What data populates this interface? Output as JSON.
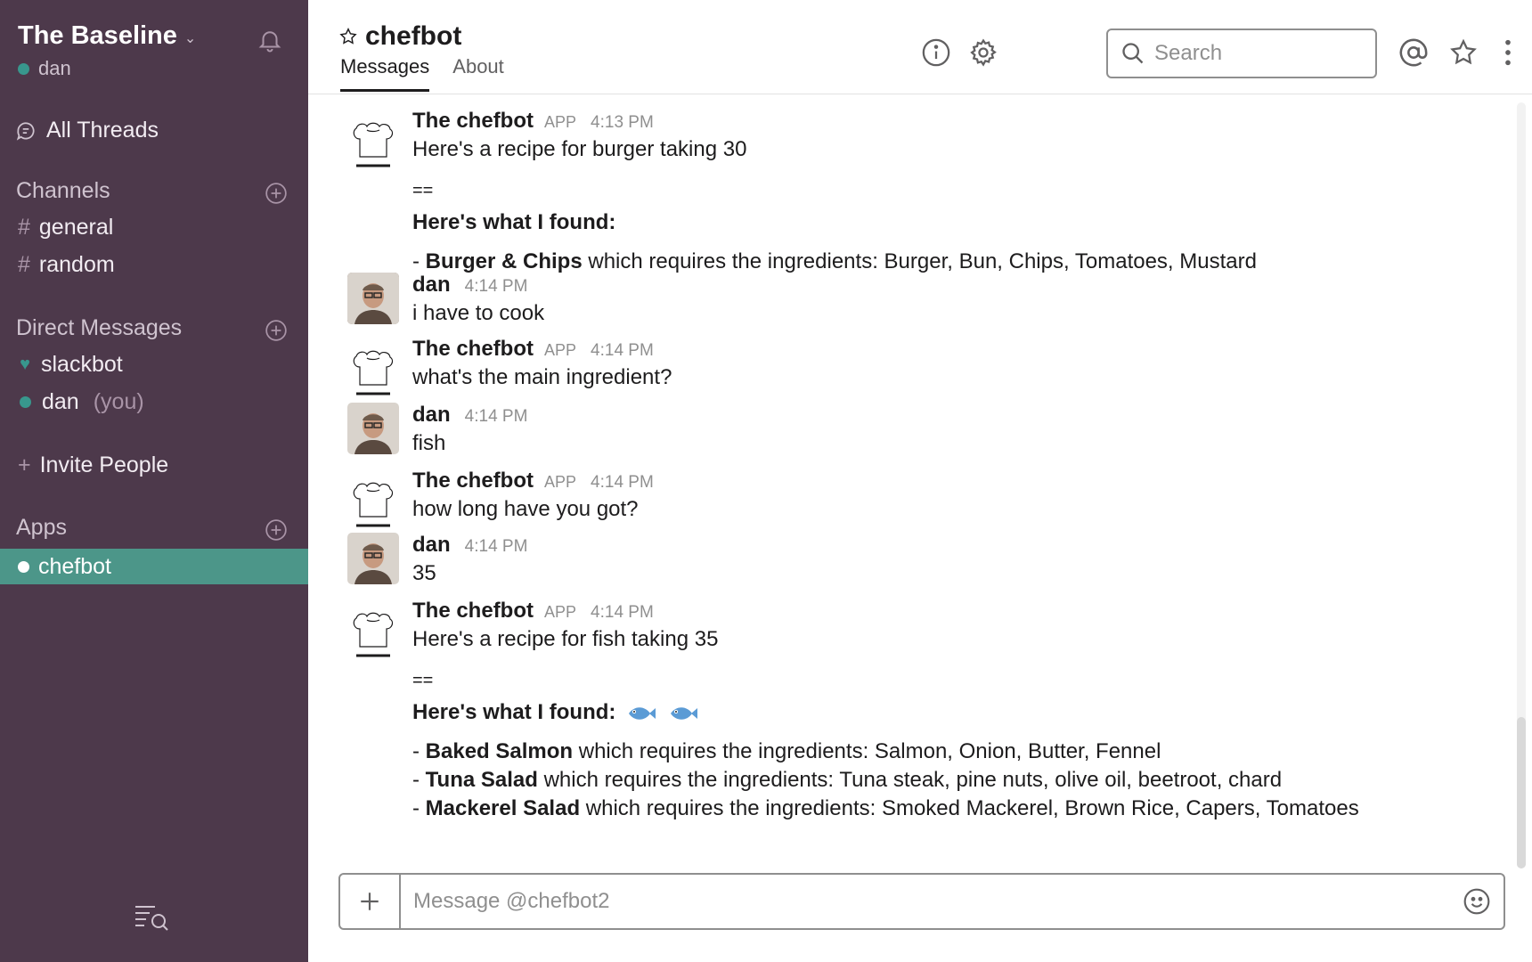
{
  "sidebar": {
    "team_name": "The Baseline",
    "user_name": "dan",
    "all_threads": "All Threads",
    "channels_heading": "Channels",
    "channels": [
      {
        "prefix": "#",
        "name": "general"
      },
      {
        "prefix": "#",
        "name": "random"
      }
    ],
    "dm_heading": "Direct Messages",
    "dms": [
      {
        "name": "slackbot",
        "suffix": ""
      },
      {
        "name": "dan",
        "suffix": "(you)"
      }
    ],
    "invite": "Invite People",
    "invite_prefix": "+",
    "apps_heading": "Apps",
    "active_app": "chefbot"
  },
  "header": {
    "channel_name": "chefbot",
    "tabs": [
      "Messages",
      "About"
    ],
    "search_placeholder": "Search"
  },
  "messages": [
    {
      "author": "The chefbot",
      "badge": "APP",
      "time": "4:13 PM",
      "lines": [
        "Here's a recipe for burger taking 30",
        "==",
        "Here's what I found:"
      ],
      "recipes": [
        {
          "dash": "- ",
          "name": "Burger & Chips",
          "rest": " which requires the ingredients: Burger, Bun, Chips, Tomatoes, Mustard"
        }
      ]
    },
    {
      "author": "dan",
      "time": "4:14 PM",
      "text": "i have to cook"
    },
    {
      "author": "The chefbot",
      "badge": "APP",
      "time": "4:14 PM",
      "text": "what's the main ingredient?"
    },
    {
      "author": "dan",
      "time": "4:14 PM",
      "text": "fish"
    },
    {
      "author": "The chefbot",
      "badge": "APP",
      "time": "4:14 PM",
      "text": "how long have you got?"
    },
    {
      "author": "dan",
      "time": "4:14 PM",
      "text": "35"
    },
    {
      "author": "The chefbot",
      "badge": "APP",
      "time": "4:14 PM",
      "lines": [
        "Here's a recipe for fish taking 35",
        "==",
        "Here's what I found:"
      ],
      "recipes": [
        {
          "dash": "- ",
          "name": "Baked Salmon",
          "rest": " which requires the ingredients: Salmon, Onion, Butter, Fennel"
        },
        {
          "dash": "- ",
          "name": "Tuna Salad",
          "rest": " which requires the ingredients: Tuna steak, pine nuts, olive oil, beetroot, chard"
        },
        {
          "dash": "- ",
          "name": "Mackerel Salad",
          "rest": " which requires the ingredients: Smoked Mackerel, Brown Rice, Capers, Tomatoes"
        }
      ]
    }
  ],
  "composer": {
    "placeholder": "Message @chefbot2"
  },
  "colors": {
    "sidebar_bg": "#4d394b",
    "active_item": "#4c9689",
    "presence": "#38978d"
  }
}
